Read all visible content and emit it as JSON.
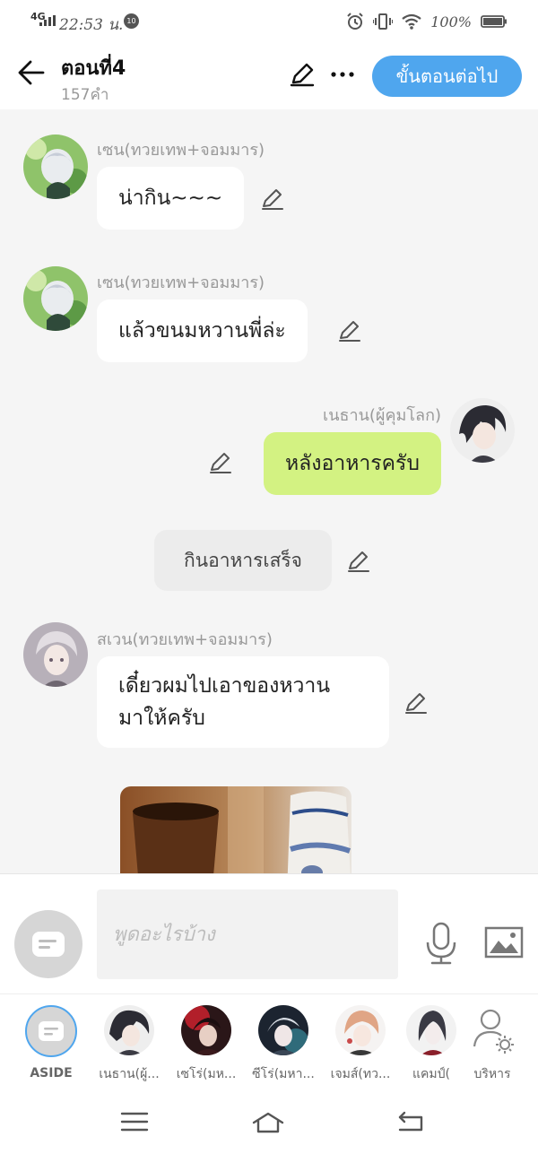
{
  "status_bar": {
    "network": "4G",
    "time": "22:53 น.",
    "notification_badge": "10",
    "battery_text": "100%"
  },
  "header": {
    "title": "ตอนที่4",
    "word_count": "157คำ",
    "next_button": "ขั้นตอนต่อไป"
  },
  "messages": [
    {
      "speaker": "เซน(ทวยเทพ+จอมมาร)",
      "text": "น่ากิน~~~",
      "side": "left"
    },
    {
      "speaker": "เซน(ทวยเทพ+จอมมาร)",
      "text": "แล้วขนมหวานพี่ล่ะ",
      "side": "left"
    },
    {
      "speaker": "เนธาน(ผู้คุมโลก)",
      "text": "หลังอาหารครับ",
      "side": "right"
    },
    {
      "text": "กินอาหารเสร็จ",
      "side": "narration"
    },
    {
      "speaker": "สเวน(ทวยเทพ+จอมมาร)",
      "text_line1": "เดี๋ยวผมไปเอาของหวาน",
      "text_line2": "มาให้ครับ",
      "side": "left"
    }
  ],
  "input": {
    "placeholder": "พูดอะไรบ้าง"
  },
  "characters": [
    {
      "label": "ASIDE"
    },
    {
      "label": "เนธาน(ผู้..."
    },
    {
      "label": "เซโร่(มห..."
    },
    {
      "label": "ซีโร่(มหา..."
    },
    {
      "label": "เจมส์(ทว..."
    },
    {
      "label": "แคมป์("
    },
    {
      "label": "บริหาร"
    }
  ],
  "colors": {
    "accent": "#4fa6ee",
    "my_bubble": "#d3f282",
    "background": "#f5f5f5"
  }
}
